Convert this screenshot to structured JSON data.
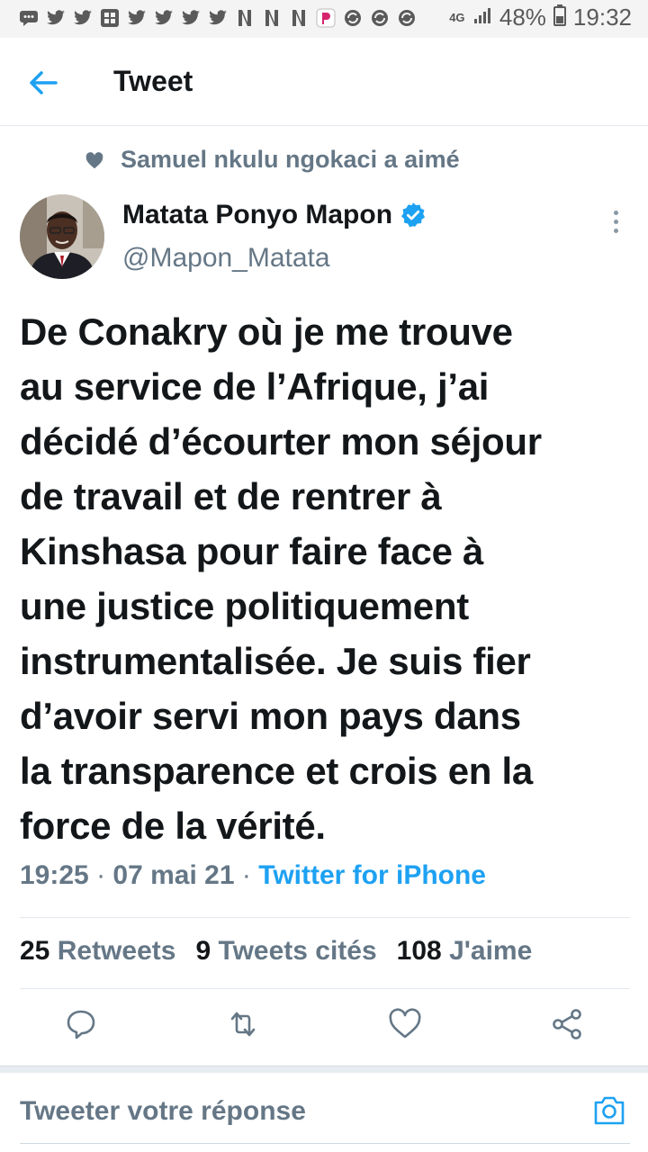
{
  "status_bar": {
    "network": "4G",
    "battery": "48%",
    "time": "19:32",
    "notification_icons": [
      "chat-icon",
      "twitter-icon",
      "twitter-icon",
      "gallery-icon",
      "twitter-icon",
      "twitter-icon",
      "twitter-icon",
      "twitter-icon",
      "twitter-icon",
      "netflix-icon",
      "netflix-icon",
      "netflix-icon",
      "p-app-icon",
      "sync-icon",
      "sync-icon",
      "sync-icon"
    ]
  },
  "header": {
    "title": "Tweet"
  },
  "social_context": {
    "text": "Samuel nkulu ngokaci a aimé"
  },
  "author": {
    "name": "Matata Ponyo Mapon",
    "handle": "@Mapon_Matata",
    "verified": true
  },
  "tweet": {
    "lines": [
      "De Conakry où je me trouve",
      "au service de l’Afrique, j’ai",
      "décidé d’écourter mon séjour",
      "de travail et de rentrer à",
      "Kinshasa pour faire face à",
      "une justice politiquement",
      "instrumentalisée. Je suis fier",
      "d’avoir servi mon pays dans",
      "la transparence et crois en la",
      "force de la vérité."
    ],
    "time": "19:25",
    "date": "07 mai 21",
    "separator": "·",
    "source": "Twitter for iPhone"
  },
  "stats": {
    "retweets_count": "25",
    "retweets_label": "Retweets",
    "quotes_count": "9",
    "quotes_label": "Tweets cités",
    "likes_count": "108",
    "likes_label": "J'aime"
  },
  "reply": {
    "placeholder": "Tweeter votre réponse"
  },
  "colors": {
    "accent": "#1da1f2",
    "secondary_text": "#657786",
    "primary_text": "#14171a"
  }
}
